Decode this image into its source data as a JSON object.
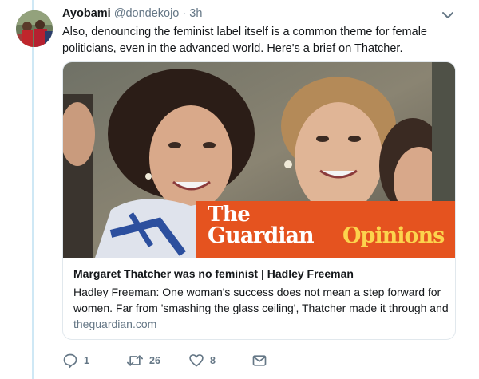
{
  "tweet": {
    "display_name": "Ayobami",
    "handle": "@dondekojo",
    "separator": "·",
    "time": "3h",
    "text": "Also, denouncing the feminist label itself is a common theme for female politicians, even in the advanced world. Here's a brief on Thatcher."
  },
  "card": {
    "title": "Margaret Thatcher was no feminist | Hadley Freeman",
    "description": "Hadley Freeman: One woman's success does not mean a step forward for women. Far from 'smashing the glass ceiling', Thatcher made it through and",
    "domain": "theguardian.com",
    "image": {
      "logo_the": "The",
      "logo_guardian": "Guardian",
      "logo_opinions": "Opinions",
      "banner_color": "#e5531f",
      "opinions_color": "#fcd34d"
    }
  },
  "actions": {
    "reply": {
      "icon": "reply-icon",
      "count": "1"
    },
    "retweet": {
      "icon": "retweet-icon",
      "count": "26"
    },
    "like": {
      "icon": "heart-icon",
      "count": "8"
    },
    "dm": {
      "icon": "envelope-icon"
    }
  },
  "colors": {
    "accent": "#1da1f2",
    "muted": "#657786",
    "thread_line": "#cfe8f5"
  }
}
